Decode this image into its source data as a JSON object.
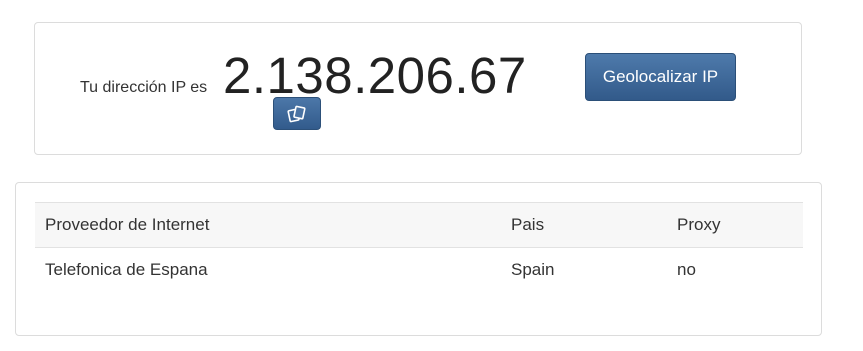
{
  "ip_panel": {
    "prefix": "Tu dirección IP es",
    "ip": "2.138.206.67",
    "copy_icon": "copy-icon",
    "geolocate_label": "Geolocalizar IP"
  },
  "info_table": {
    "headers": [
      "Proveedor de Internet",
      "Pais",
      "Proxy"
    ],
    "rows": [
      [
        "Telefonica de Espana",
        "Spain",
        "no"
      ]
    ]
  },
  "colors": {
    "button_blue": "#3d679a",
    "panel_border": "#dcdcdc",
    "header_bg": "#f7f7f7"
  }
}
